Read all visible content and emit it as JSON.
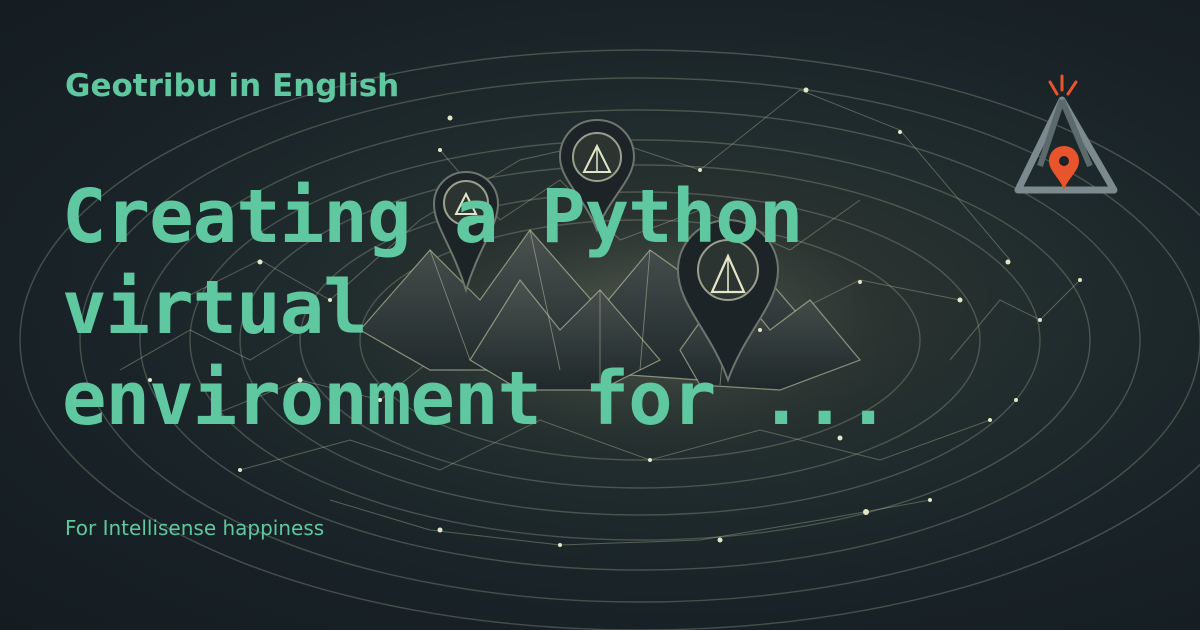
{
  "header": {
    "site_name": "Geotribu in English"
  },
  "article": {
    "title_lines": [
      "Creating a Python",
      "virtual",
      "environment for ..."
    ],
    "subtitle": "For Intellisense happiness"
  },
  "colors": {
    "accent_text": "#5fc8a0",
    "logo_accent": "#e8542c",
    "background": "#1a2326"
  },
  "icons": {
    "logo": "geotribu-tent-pin-logo",
    "map_pins": "map-pin-icon"
  }
}
